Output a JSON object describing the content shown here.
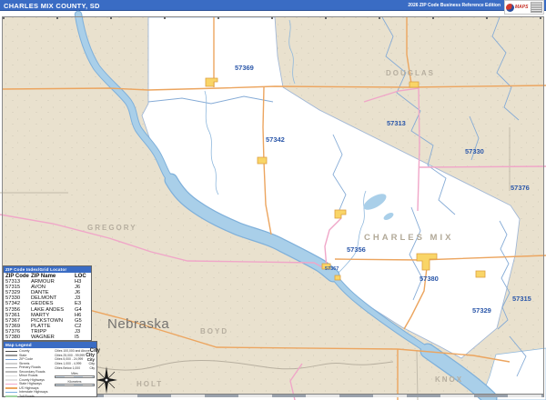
{
  "header": {
    "title": "CHARLES MIX COUNTY, SD",
    "edition": "2026 ZIP Code Business Reference Edition",
    "logo_text": "MAPS"
  },
  "map": {
    "state_label": "Nebraska",
    "county_labels": {
      "gregory": "GREGORY",
      "douglas": "DOUGLAS",
      "charles_mix": "CHARLES MIX",
      "boyd": "BOYD",
      "holt": "HOLT",
      "knox": "KNOX"
    },
    "zip_labels": [
      {
        "text": "57369"
      },
      {
        "text": "57342"
      },
      {
        "text": "57313"
      },
      {
        "text": "57330"
      },
      {
        "text": "57376"
      },
      {
        "text": "57356"
      },
      {
        "text": "57380"
      },
      {
        "text": "57329"
      },
      {
        "text": "57315"
      },
      {
        "text": "57367"
      }
    ]
  },
  "index_table": {
    "title": "ZIP Code Index/Grid Locator",
    "columns": [
      "ZIP Code",
      "ZIP Name",
      "LOC"
    ],
    "rows": [
      {
        "zip": "57313",
        "name": "ARMOUR",
        "loc": "H3"
      },
      {
        "zip": "57315",
        "name": "AVON",
        "loc": "J6"
      },
      {
        "zip": "57329",
        "name": "DANTE",
        "loc": "J6"
      },
      {
        "zip": "57330",
        "name": "DELMONT",
        "loc": "J3"
      },
      {
        "zip": "57342",
        "name": "GEDDES",
        "loc": "E3"
      },
      {
        "zip": "57356",
        "name": "LAKE ANDES",
        "loc": "G4"
      },
      {
        "zip": "57361",
        "name": "MARTY",
        "loc": "H6"
      },
      {
        "zip": "57367",
        "name": "PICKSTOWN",
        "loc": "G5"
      },
      {
        "zip": "57369",
        "name": "PLATTE",
        "loc": "C2"
      },
      {
        "zip": "57376",
        "name": "TRIPP",
        "loc": "J3"
      },
      {
        "zip": "57380",
        "name": "WAGNER",
        "loc": "I5"
      }
    ]
  },
  "legend": {
    "title": "Map Legend",
    "line_items": [
      {
        "label": "County",
        "color": "#4a4a4a"
      },
      {
        "label": "State",
        "color": "#9a9a9a"
      },
      {
        "label": "ZIP Code",
        "color": "#7aa3d4"
      },
      {
        "label": "Streets",
        "color": "#cfcfcf"
      },
      {
        "label": "Primary Roads",
        "color": "#a8a8a8"
      },
      {
        "label": "Secondary Roads",
        "color": "#bcbcbc"
      },
      {
        "label": "Minor Roads",
        "color": "#d8d8d8"
      },
      {
        "label": "County Highways",
        "color": "#e2e2e2"
      },
      {
        "label": "State Highways",
        "color": "#f0a6c8"
      },
      {
        "label": "US Highways",
        "color": "#eca55f"
      },
      {
        "label": "Interstate Highways",
        "color": "#7ab0e0"
      },
      {
        "label": "Toll Roads",
        "color": "#9fd49f"
      }
    ],
    "city_items": [
      {
        "label": "Cities 100,000 and Above",
        "sample": "City"
      },
      {
        "label": "Cities 25,000 - 99,999",
        "sample": "City"
      },
      {
        "label": "Cities 5,000 - 24,999",
        "sample": "City"
      },
      {
        "label": "Cities 1,000 - 4,999",
        "sample": "City"
      },
      {
        "label": "Cities Below 1,000",
        "sample": "City"
      }
    ],
    "scale": {
      "miles": "Miles",
      "km": "Kilometers"
    }
  },
  "colors": {
    "title_bar": "#3a6cc4",
    "land": "#e9e1ce",
    "county_fill": "#ffffff",
    "water": "#a9cfe9",
    "zip_label": "#2b57a9",
    "us_highway": "#eca55f",
    "state_highway": "#f0a6c8",
    "city_fill": "#f9d567"
  }
}
